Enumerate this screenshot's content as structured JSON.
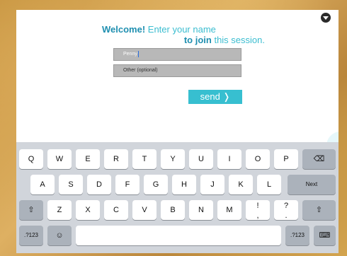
{
  "welcome": {
    "bold1": "Welcome!",
    "text1": " Enter your name",
    "bold2": "to join",
    "text2": " this session."
  },
  "form": {
    "name_value": "Penny",
    "other_placeholder": "Other (optional)",
    "send_label": "send ❭"
  },
  "keyboard": {
    "row1": [
      "Q",
      "W",
      "E",
      "R",
      "T",
      "Y",
      "U",
      "I",
      "O",
      "P"
    ],
    "row2": [
      "A",
      "S",
      "D",
      "F",
      "G",
      "H",
      "J",
      "K",
      "L"
    ],
    "row3": [
      "Z",
      "X",
      "C",
      "V",
      "B",
      "N",
      "M"
    ],
    "exclaim_top": "!",
    "exclaim_bottom": ",",
    "question_top": "?",
    "question_bottom": ".",
    "next_label": "Next",
    "numbers_label": ".?123",
    "delete_icon": "⌫",
    "shift_icon": "⇧",
    "emoji_icon": "☺",
    "keyboard_icon": "⌨"
  },
  "colors": {
    "accent": "#37bfd0",
    "accent_dark": "#1f8fb0",
    "keyboard_bg": "#d1d5db"
  }
}
